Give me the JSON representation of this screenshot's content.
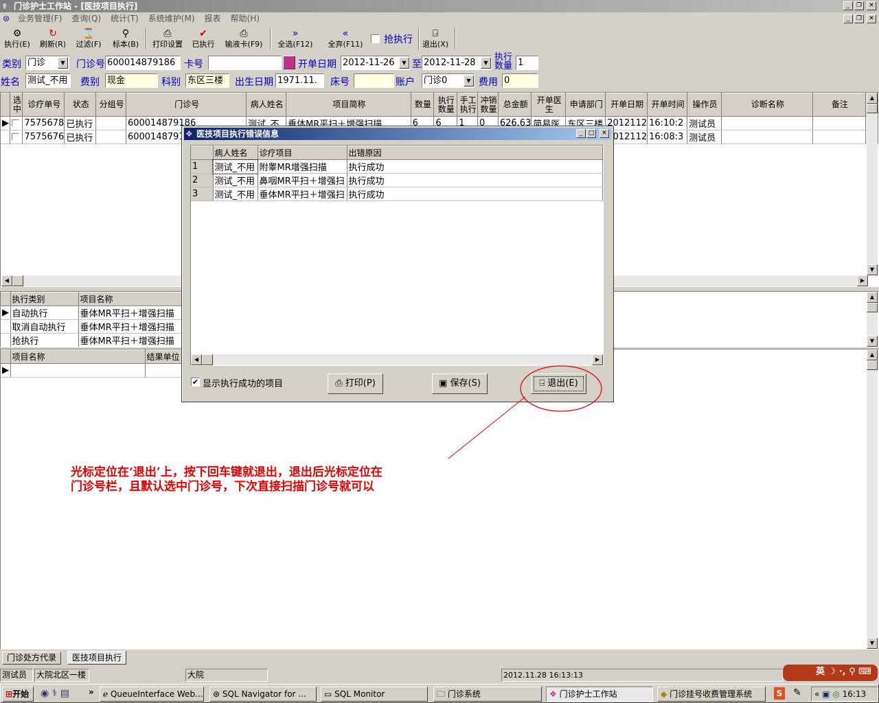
{
  "window": {
    "title": "门诊护士工作站 - [医技项目执行]"
  },
  "menu": [
    "业务管理(F)",
    "查询(Q)",
    "统计(T)",
    "系统维护(M)",
    "报表",
    "帮助(H)"
  ],
  "toolbar": {
    "execute": "执行(E)",
    "refresh": "刷新(R)",
    "filter": "过滤(F)",
    "label": "标本(B)",
    "print_setup": "打印设置",
    "executed": "已执行",
    "infusion_card": "输液卡(F9)",
    "select_all": "全选(F12)",
    "deselect_all": "全弃(F11)",
    "rush_execute": "抢执行",
    "exit": "退出(X)"
  },
  "form": {
    "category_label": "类别",
    "category_value": "门诊",
    "clinic_no_label": "门诊号",
    "clinic_no_value": "600014879186",
    "card_no_label": "卡号",
    "card_no_value": "",
    "start_date_label": "开单日期",
    "start_date_from": "2012-11-26",
    "to_label": "至",
    "start_date_to": "2012-11-28",
    "exec_qty_label": "执行数量",
    "exec_qty_value": "1",
    "name_label": "姓名",
    "name_value": "测试_不用",
    "fee_type_label": "费别",
    "fee_type_value": "现金",
    "dept_label": "科别",
    "dept_value": "东区三楼",
    "birth_label": "出生日期",
    "birth_value": "1971.11.",
    "bed_label": "床号",
    "bed_value": "",
    "account_label": "账户",
    "account_value": "门诊0",
    "fee_label": "费用",
    "fee_value": "0"
  },
  "main_grid": {
    "columns": [
      "选中",
      "诊疗单号",
      "状态",
      "分组号",
      "门诊号",
      "病人姓名",
      "项目简称",
      "数量",
      "执行数量",
      "手工执行",
      "冲销数量",
      "总金额",
      "开单医生",
      "申请部门",
      "开单日期",
      "开单时间",
      "操作员",
      "诊断名称",
      "备注"
    ],
    "rows": [
      [
        "",
        "7575678",
        "已执行",
        "",
        "600014879186",
        "测试_不",
        "垂体MR平扫＋增强扫描",
        "6",
        "6",
        "1",
        "0",
        "626.63",
        "简易医",
        "东区三楼",
        "2012112",
        "16:10:2",
        "测试员",
        "",
        ""
      ],
      [
        "",
        "7575676",
        "已执行",
        "",
        "600014879186",
        "",
        "",
        "",
        "",
        "",
        "",
        "",
        "",
        "",
        "2012112",
        "16:08:3",
        "测试员",
        "",
        ""
      ]
    ]
  },
  "exec_grid": {
    "columns": [
      "执行类别",
      "项目名称"
    ],
    "rows": [
      [
        "自动执行",
        "垂体MR平扫＋增强扫描"
      ],
      [
        "取消自动执行",
        "垂体MR平扫＋增强扫描"
      ],
      [
        "抢执行",
        "垂体MR平扫＋增强扫描"
      ]
    ]
  },
  "result_grid": {
    "columns": [
      "项目名称",
      "结果单位"
    ]
  },
  "dialog": {
    "title": "医技项目执行错误信息",
    "columns": [
      "病人姓名",
      "诊疗项目",
      "出错原因"
    ],
    "rows": [
      [
        "1",
        "测试_不用",
        "附睾MR增强扫描",
        "执行成功"
      ],
      [
        "2",
        "测试_不用",
        "鼻咽MR平扫＋增强扫",
        "执行成功"
      ],
      [
        "3",
        "测试_不用",
        "垂体MR平扫＋增强扫",
        "执行成功"
      ]
    ],
    "show_success_label": "显示执行成功的项目",
    "show_success_checked": true,
    "print_button": "打印(P)",
    "save_button": "保存(S)",
    "exit_button": "退出(E)"
  },
  "annotation": {
    "line1": "光标定位在‘退出’上，按下回车键就退出，退出后光标定位在",
    "line2": "门诊号栏，且默认选中门诊号，下次直接扫描门诊号就可以",
    "color": "#e00000"
  },
  "bottom_tabs": [
    "门诊处方代录",
    "医技项目执行"
  ],
  "statusbar": {
    "operator": "测试员",
    "location": "大院北区一楼",
    "campus": "大院",
    "datetime": "2012.11.28 16:13:13"
  },
  "taskbar": {
    "start": "开始",
    "tasks": [
      "QueueInterface Web...",
      "SQL Navigator for ...",
      "SQL Monitor",
      "门诊系统",
      "门诊护士工作站",
      "门诊挂号收费管理系统"
    ],
    "ime": "英",
    "clock": "16:13"
  }
}
